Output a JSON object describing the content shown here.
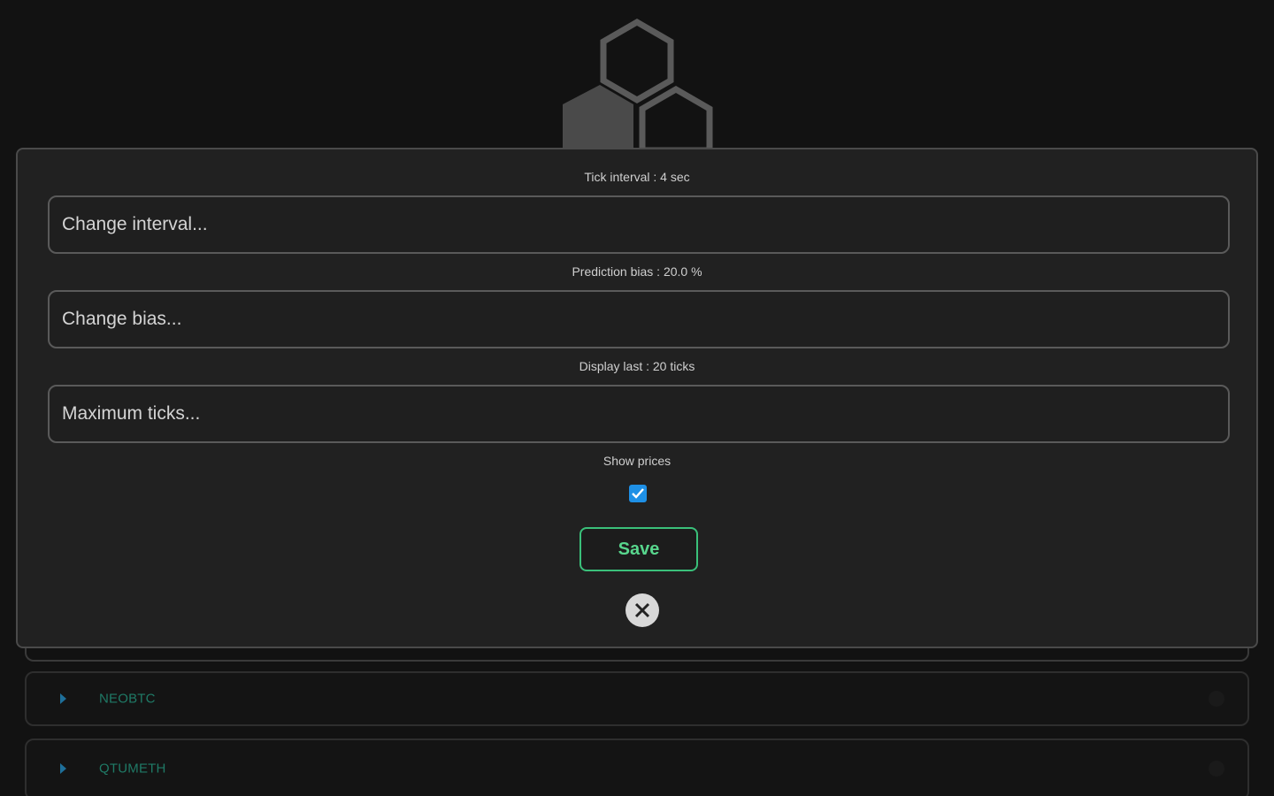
{
  "modal": {
    "tick_interval_label": "Tick interval : 4 sec",
    "interval_placeholder": "Change interval...",
    "bias_label": "Prediction bias : 20.0 %",
    "bias_placeholder": "Change bias...",
    "display_label": "Display last : 20 ticks",
    "max_ticks_placeholder": "Maximum ticks...",
    "show_prices_label": "Show prices",
    "show_prices_checked": true,
    "save_label": "Save",
    "close_icon": "close-icon"
  },
  "list": {
    "rows": [
      {
        "symbol": "NEOBTC",
        "icon": "chevron-right-icon"
      },
      {
        "symbol": "QTUMETH",
        "icon": "chevron-right-icon"
      }
    ]
  },
  "colors": {
    "background": "#121212",
    "modal": "#212121",
    "accent_green": "#3ac07a",
    "checkbox_blue": "#1e90e6",
    "symbol_teal": "#1f7a66"
  },
  "logo": {
    "icon": "hexagon-logo-icon"
  }
}
